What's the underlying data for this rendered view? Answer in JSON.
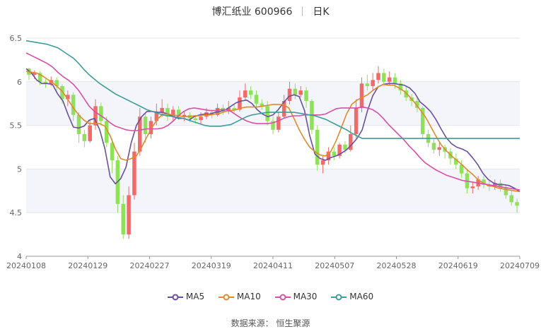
{
  "header": {
    "title": "博汇纸业 600966",
    "period": "日K"
  },
  "source": "数据来源： 恒生聚源",
  "colors": {
    "up": "#f06a6a",
    "down": "#8fe05a",
    "ma5": "#6a4fa0",
    "ma10": "#e08a2c",
    "ma30": "#d94fa8",
    "ma60": "#3f9c9a",
    "band": "#f4f5fa",
    "grid": "#e6e6e6",
    "axis": "#999999"
  },
  "chart_data": {
    "type": "candlestick",
    "ylim": [
      4,
      6.5
    ],
    "yticks": [
      "4",
      "4.5",
      "5",
      "5.5",
      "6",
      "6.5"
    ],
    "xtick_labels": [
      "20240108",
      "20240129",
      "20240227",
      "20240319",
      "20240411",
      "20240507",
      "20240528",
      "20240619",
      "20240709"
    ],
    "xtick_index": [
      0,
      15,
      30,
      45,
      60,
      75,
      90,
      105,
      120
    ],
    "series": [
      {
        "name": "MA5",
        "values": [
          6.15,
          6.1,
          6.02,
          5.98,
          5.98,
          5.97,
          5.86,
          5.78,
          5.62,
          5.48,
          5.47,
          5.49,
          5.56,
          5.58,
          5.45,
          5.23,
          4.91,
          4.83,
          4.89,
          5.02,
          5.3,
          5.5,
          5.6,
          5.66,
          5.66,
          5.65,
          5.65,
          5.63,
          5.6,
          5.58,
          5.58,
          5.56,
          5.6,
          5.62,
          5.63,
          5.63,
          5.65,
          5.66,
          5.68,
          5.72,
          5.76,
          5.78,
          5.79,
          5.75,
          5.68,
          5.63,
          5.6,
          5.62,
          5.68,
          5.76,
          5.83,
          5.85,
          5.83,
          5.67,
          5.38,
          5.17,
          5.12,
          5.1,
          5.13,
          5.15,
          5.18,
          5.22,
          5.28,
          5.35,
          5.45,
          5.67,
          5.84,
          5.94,
          5.97,
          5.98,
          5.98,
          5.97,
          5.96,
          5.93,
          5.87,
          5.77,
          5.72,
          5.66,
          5.57,
          5.46,
          5.36,
          5.29,
          5.25,
          5.23,
          5.2,
          5.13,
          5.05,
          4.95,
          4.88,
          4.84,
          4.82,
          4.82,
          4.81,
          4.78,
          4.74
        ]
      },
      {
        "name": "MA10",
        "values": [
          6.12,
          6.11,
          6.1,
          6.07,
          6.03,
          5.99,
          5.94,
          5.88,
          5.79,
          5.7,
          5.62,
          5.56,
          5.52,
          5.52,
          5.52,
          5.49,
          5.38,
          5.23,
          5.12,
          5.1,
          5.12,
          5.15,
          5.25,
          5.37,
          5.48,
          5.57,
          5.63,
          5.63,
          5.62,
          5.61,
          5.6,
          5.6,
          5.61,
          5.61,
          5.62,
          5.62,
          5.63,
          5.64,
          5.66,
          5.67,
          5.68,
          5.7,
          5.71,
          5.71,
          5.71,
          5.72,
          5.73,
          5.74,
          5.74,
          5.74,
          5.7,
          5.58,
          5.45,
          5.34,
          5.25,
          5.2,
          5.16,
          5.15,
          5.2,
          5.32,
          5.47,
          5.63,
          5.74,
          5.79,
          5.82,
          5.85,
          5.9,
          5.94,
          5.97,
          5.96,
          5.96,
          5.93,
          5.89,
          5.83,
          5.76,
          5.68,
          5.6,
          5.49,
          5.38,
          5.28,
          5.21,
          5.15,
          5.1,
          5.05,
          4.99,
          4.94,
          4.88,
          4.84,
          4.81,
          4.8,
          4.78,
          4.77,
          4.76,
          4.75,
          4.74
        ]
      },
      {
        "name": "MA30",
        "values": [
          6.33,
          6.3,
          6.27,
          6.24,
          6.21,
          6.17,
          6.11,
          6.06,
          6.02,
          5.97,
          5.9,
          5.81,
          5.72,
          5.66,
          5.62,
          5.58,
          5.53,
          5.49,
          5.47,
          5.45,
          5.44,
          5.44,
          5.45,
          5.46,
          5.46,
          5.46,
          5.47,
          5.5,
          5.55,
          5.61,
          5.66,
          5.69,
          5.7,
          5.69,
          5.68,
          5.67,
          5.67,
          5.68,
          5.68,
          5.66,
          5.62,
          5.58,
          5.55,
          5.53,
          5.52,
          5.52,
          5.52,
          5.53,
          5.55,
          5.58,
          5.6,
          5.61,
          5.61,
          5.62,
          5.62,
          5.62,
          5.62,
          5.63,
          5.66,
          5.69,
          5.7,
          5.7,
          5.7,
          5.7,
          5.71,
          5.7,
          5.68,
          5.64,
          5.58,
          5.51,
          5.45,
          5.39,
          5.33,
          5.26,
          5.2,
          5.13,
          5.07,
          5.03,
          4.99,
          4.96,
          4.93,
          4.91,
          4.89,
          4.87,
          4.86,
          4.85,
          4.84,
          4.83,
          4.82,
          4.81,
          4.8,
          4.79,
          4.78,
          4.77,
          4.76
        ]
      },
      {
        "name": "MA60",
        "values": [
          6.47,
          6.46,
          6.45,
          6.44,
          6.43,
          6.41,
          6.39,
          6.35,
          6.31,
          6.27,
          6.21,
          6.14,
          6.08,
          6.03,
          5.98,
          5.94,
          5.9,
          5.86,
          5.83,
          5.8,
          5.77,
          5.74,
          5.71,
          5.68,
          5.66,
          5.64,
          5.62,
          5.61,
          5.6,
          5.59,
          5.58,
          5.56,
          5.54,
          5.52,
          5.5,
          5.49,
          5.49,
          5.49,
          5.5,
          5.51,
          5.54,
          5.57,
          5.6,
          5.62,
          5.63,
          5.64,
          5.65,
          5.65,
          5.65,
          5.65,
          5.65,
          5.65,
          5.64,
          5.63,
          5.62,
          5.61,
          5.59,
          5.57,
          5.54,
          5.51,
          5.48,
          5.45,
          5.41,
          5.38,
          5.35,
          5.35,
          5.35,
          5.35,
          5.35,
          5.35,
          5.35,
          5.35,
          5.35,
          5.35,
          5.35,
          5.35,
          5.35,
          5.35,
          5.35,
          5.35,
          5.35,
          5.35,
          5.35,
          5.35,
          5.35,
          5.35,
          5.35,
          5.35,
          5.35,
          5.35,
          5.35,
          5.35,
          5.35,
          5.35,
          5.35
        ]
      }
    ],
    "candles": [
      [
        6.15,
        6.08,
        6.16,
        6.02
      ],
      [
        6.08,
        6.1,
        6.13,
        6.03
      ],
      [
        6.1,
        6.0,
        6.12,
        5.96
      ],
      [
        6.0,
        5.98,
        6.03,
        5.93
      ],
      [
        5.98,
        6.02,
        6.06,
        5.95
      ],
      [
        6.02,
        5.95,
        6.05,
        5.9
      ],
      [
        5.95,
        5.8,
        5.97,
        5.75
      ],
      [
        5.8,
        5.85,
        5.9,
        5.72
      ],
      [
        5.85,
        5.62,
        5.88,
        5.55
      ],
      [
        5.62,
        5.4,
        5.65,
        5.3
      ],
      [
        5.4,
        5.32,
        5.45,
        5.25
      ],
      [
        5.32,
        5.5,
        5.56,
        5.3
      ],
      [
        5.5,
        5.72,
        5.8,
        5.45
      ],
      [
        5.72,
        5.55,
        5.76,
        5.5
      ],
      [
        5.55,
        5.3,
        5.6,
        5.25
      ],
      [
        5.3,
        5.1,
        5.35,
        4.95
      ],
      [
        5.1,
        4.6,
        5.15,
        4.5
      ],
      [
        4.6,
        4.25,
        4.7,
        4.2
      ],
      [
        4.25,
        4.7,
        4.8,
        4.2
      ],
      [
        4.7,
        5.2,
        5.3,
        4.65
      ],
      [
        5.2,
        5.6,
        5.7,
        5.15
      ],
      [
        5.6,
        5.4,
        5.65,
        5.3
      ],
      [
        5.4,
        5.55,
        5.6,
        5.35
      ],
      [
        5.55,
        5.65,
        5.75,
        5.5
      ],
      [
        5.65,
        5.7,
        5.8,
        5.6
      ],
      [
        5.7,
        5.6,
        5.75,
        5.55
      ],
      [
        5.6,
        5.68,
        5.72,
        5.55
      ],
      [
        5.68,
        5.6,
        5.72,
        5.56
      ],
      [
        5.6,
        5.62,
        5.66,
        5.55
      ],
      [
        5.62,
        5.58,
        5.65,
        5.54
      ],
      [
        5.58,
        5.56,
        5.62,
        5.52
      ],
      [
        5.56,
        5.6,
        5.65,
        5.52
      ],
      [
        5.6,
        5.65,
        5.7,
        5.57
      ],
      [
        5.65,
        5.62,
        5.68,
        5.58
      ],
      [
        5.62,
        5.7,
        5.75,
        5.6
      ],
      [
        5.7,
        5.66,
        5.74,
        5.62
      ],
      [
        5.66,
        5.7,
        5.78,
        5.63
      ],
      [
        5.7,
        5.68,
        5.75,
        5.65
      ],
      [
        5.68,
        5.82,
        5.9,
        5.66
      ],
      [
        5.82,
        5.9,
        5.98,
        5.78
      ],
      [
        5.9,
        5.85,
        5.95,
        5.8
      ],
      [
        5.85,
        5.75,
        5.9,
        5.7
      ],
      [
        5.75,
        5.72,
        5.8,
        5.68
      ],
      [
        5.72,
        5.55,
        5.78,
        5.5
      ],
      [
        5.55,
        5.45,
        5.6,
        5.4
      ],
      [
        5.45,
        5.6,
        5.65,
        5.42
      ],
      [
        5.6,
        5.78,
        5.85,
        5.58
      ],
      [
        5.78,
        5.92,
        6.0,
        5.74
      ],
      [
        5.92,
        5.85,
        5.98,
        5.8
      ],
      [
        5.85,
        5.9,
        5.95,
        5.82
      ],
      [
        5.9,
        5.78,
        5.94,
        5.7
      ],
      [
        5.78,
        5.45,
        5.8,
        5.4
      ],
      [
        5.45,
        5.05,
        5.5,
        4.98
      ],
      [
        5.05,
        5.1,
        5.15,
        4.95
      ],
      [
        5.1,
        5.2,
        5.25,
        5.05
      ],
      [
        5.2,
        5.15,
        5.25,
        5.1
      ],
      [
        5.15,
        5.28,
        5.3,
        5.12
      ],
      [
        5.28,
        5.22,
        5.32,
        5.18
      ],
      [
        5.22,
        5.4,
        5.5,
        5.2
      ],
      [
        5.4,
        5.7,
        5.8,
        5.35
      ],
      [
        5.7,
        5.98,
        6.05,
        5.65
      ],
      [
        5.98,
        5.95,
        6.08,
        5.9
      ],
      [
        5.95,
        6.02,
        6.1,
        5.9
      ],
      [
        6.02,
        6.1,
        6.18,
        5.98
      ],
      [
        6.1,
        6.0,
        6.15,
        5.95
      ],
      [
        6.0,
        6.05,
        6.12,
        5.96
      ],
      [
        6.05,
        5.98,
        6.1,
        5.92
      ],
      [
        5.98,
        5.9,
        6.02,
        5.85
      ],
      [
        5.9,
        5.82,
        5.95,
        5.78
      ],
      [
        5.82,
        5.78,
        5.86,
        5.72
      ],
      [
        5.78,
        5.7,
        5.82,
        5.65
      ],
      [
        5.7,
        5.4,
        5.72,
        5.35
      ],
      [
        5.4,
        5.3,
        5.45,
        5.25
      ],
      [
        5.3,
        5.22,
        5.35,
        5.18
      ],
      [
        5.22,
        5.25,
        5.3,
        5.15
      ],
      [
        5.25,
        5.2,
        5.28,
        5.12
      ],
      [
        5.2,
        5.12,
        5.24,
        5.05
      ],
      [
        5.12,
        5.05,
        5.18,
        5.0
      ],
      [
        5.05,
        4.95,
        5.1,
        4.9
      ],
      [
        4.95,
        4.78,
        5.0,
        4.72
      ],
      [
        4.78,
        4.8,
        4.85,
        4.72
      ],
      [
        4.8,
        4.88,
        4.92,
        4.76
      ],
      [
        4.88,
        4.82,
        4.92,
        4.78
      ],
      [
        4.82,
        4.8,
        4.86,
        4.75
      ],
      [
        4.8,
        4.84,
        4.88,
        4.76
      ],
      [
        4.84,
        4.78,
        4.88,
        4.74
      ],
      [
        4.78,
        4.7,
        4.82,
        4.66
      ],
      [
        4.7,
        4.62,
        4.75,
        4.58
      ],
      [
        4.62,
        4.58,
        4.66,
        4.5
      ]
    ]
  }
}
